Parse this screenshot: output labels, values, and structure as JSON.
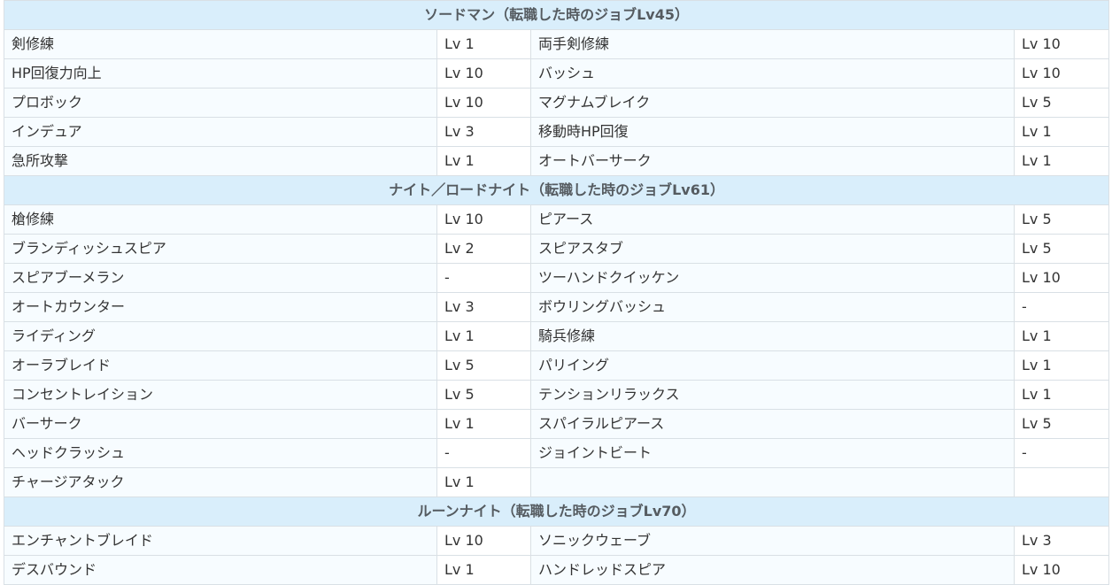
{
  "sections": [
    {
      "title": "ソードマン（転職した時のジョブLv45）",
      "rows": [
        [
          "剣修練",
          "Lv 1",
          "両手剣修練",
          "Lv 10"
        ],
        [
          "HP回復力向上",
          "Lv 10",
          "バッシュ",
          "Lv 10"
        ],
        [
          "プロボック",
          "Lv 10",
          "マグナムブレイク",
          "Lv 5"
        ],
        [
          "インデュア",
          "Lv 3",
          "移動時HP回復",
          "Lv 1"
        ],
        [
          "急所攻撃",
          "Lv 1",
          "オートバーサーク",
          "Lv 1"
        ]
      ]
    },
    {
      "title": "ナイト／ロードナイト（転職した時のジョブLv61）",
      "rows": [
        [
          "槍修練",
          "Lv 10",
          "ピアース",
          "Lv 5"
        ],
        [
          "ブランディッシュスピア",
          "Lv 2",
          "スピアスタブ",
          "Lv 5"
        ],
        [
          "スピアブーメラン",
          "-",
          "ツーハンドクイッケン",
          "Lv 10"
        ],
        [
          "オートカウンター",
          "Lv 3",
          "ボウリングバッシュ",
          "-"
        ],
        [
          "ライディング",
          "Lv 1",
          "騎兵修練",
          "Lv 1"
        ],
        [
          "オーラブレイド",
          "Lv 5",
          "パリイング",
          "Lv 1"
        ],
        [
          "コンセントレイション",
          "Lv 5",
          "テンションリラックス",
          "Lv 1"
        ],
        [
          "バーサーク",
          "Lv 1",
          "スパイラルピアース",
          "Lv 5"
        ],
        [
          "ヘッドクラッシュ",
          "-",
          "ジョイントビート",
          "-"
        ],
        [
          "チャージアタック",
          "Lv 1",
          "",
          ""
        ]
      ]
    },
    {
      "title": "ルーンナイト（転職した時のジョブLv70）",
      "rows": [
        [
          "エンチャントブレイド",
          "Lv 10",
          "ソニックウェーブ",
          "Lv 3"
        ],
        [
          "デスバウンド",
          "Lv 1",
          "ハンドレッドスピア",
          "Lv 10"
        ]
      ]
    }
  ]
}
